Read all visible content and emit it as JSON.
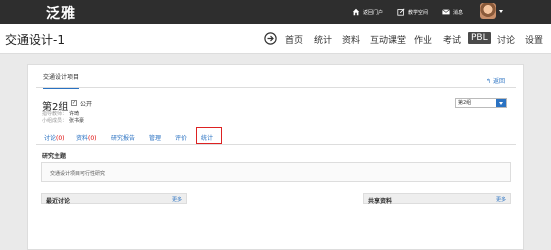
{
  "topbar": {
    "logo": "泛雅",
    "nav": [
      {
        "label": "返回门户",
        "icon": "home-icon"
      },
      {
        "label": "教学空间",
        "icon": "edit-icon"
      },
      {
        "label": "消息",
        "icon": "mail-icon"
      }
    ]
  },
  "course": {
    "title": "交通设计-1",
    "nav": [
      "首页",
      "统计",
      "资料",
      "互动课堂",
      "作业",
      "考试",
      "PBL",
      "讨论",
      "设置"
    ],
    "active": "PBL"
  },
  "project": {
    "tab": "交通设计项目",
    "return_label": "返回",
    "group_name": "第2组",
    "public_check": "✓",
    "public_label": "公开",
    "teacher_label": "指导教师：",
    "teacher": "许琦",
    "members_label": "小组成员：",
    "members": "张书豪",
    "group_select": "第2组"
  },
  "subtabs": [
    {
      "label": "讨论",
      "count": "(0)"
    },
    {
      "label": "资料",
      "count": "(0)"
    },
    {
      "label": "研究报告",
      "count": ""
    },
    {
      "label": "管理",
      "count": ""
    },
    {
      "label": "评价",
      "count": ""
    },
    {
      "label": "统计",
      "count": ""
    }
  ],
  "topic": {
    "title": "研究主题",
    "text": "交通设计项目可行性研究"
  },
  "panels": {
    "discussion": {
      "title": "最近讨论",
      "more": "更多"
    },
    "shared": {
      "title": "共享资料",
      "more": "更多"
    }
  }
}
